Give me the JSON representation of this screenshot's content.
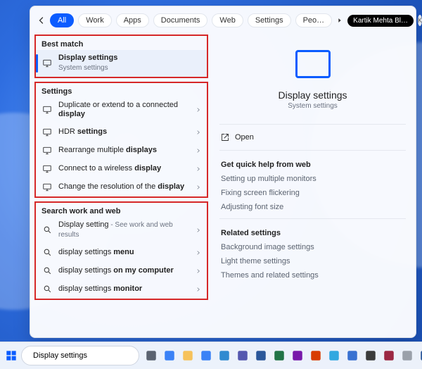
{
  "tabs": {
    "items": [
      "All",
      "Work",
      "Apps",
      "Documents",
      "Web",
      "Settings",
      "Peo…"
    ],
    "active_index": 0,
    "user_chip": "Kartik Mehta Bl…",
    "user_initial": "K"
  },
  "best_match": {
    "header": "Best match",
    "title": "Display settings",
    "subtitle": "System settings"
  },
  "settings": {
    "header": "Settings",
    "items": [
      {
        "pre": "Duplicate or extend to a connected ",
        "bold": "display"
      },
      {
        "pre": "HDR ",
        "bold": "settings"
      },
      {
        "pre": "Rearrange multiple ",
        "bold": "displays"
      },
      {
        "pre": "Connect to a wireless ",
        "bold": "display"
      },
      {
        "pre": "Change the resolution of the ",
        "bold": "display"
      }
    ]
  },
  "web": {
    "header": "Search work and web",
    "items": [
      {
        "pre": "Display setting",
        "suffix": " - See work and web results"
      },
      {
        "pre": "display settings ",
        "bold": "menu"
      },
      {
        "pre": "display settings ",
        "bold": "on my computer"
      },
      {
        "pre": "display settings ",
        "bold": "monitor"
      }
    ]
  },
  "preview": {
    "title": "Display settings",
    "subtitle": "System settings",
    "open_label": "Open",
    "quick_help_header": "Get quick help from web",
    "quick_help": [
      "Setting up multiple monitors",
      "Fixing screen flickering",
      "Adjusting font size"
    ],
    "related_header": "Related settings",
    "related": [
      "Background image settings",
      "Light theme settings",
      "Themes and related settings"
    ]
  },
  "taskbar": {
    "search_value": "Display settings",
    "pinned": [
      {
        "name": "task-view",
        "color": "#5b6370"
      },
      {
        "name": "widgets",
        "color": "#3b82f6"
      },
      {
        "name": "explorer",
        "color": "#f6c25b"
      },
      {
        "name": "store",
        "color": "#3b82f6"
      },
      {
        "name": "mail",
        "color": "#2f8ad0"
      },
      {
        "name": "teams",
        "color": "#5558af"
      },
      {
        "name": "word",
        "color": "#2b579a"
      },
      {
        "name": "excel",
        "color": "#217346"
      },
      {
        "name": "onenote",
        "color": "#7719aa"
      },
      {
        "name": "snip",
        "color": "#d83b01"
      },
      {
        "name": "edge",
        "color": "#31a8e0"
      },
      {
        "name": "todo",
        "color": "#3971d1"
      },
      {
        "name": "app-b",
        "color": "#3b3b3b"
      },
      {
        "name": "camera",
        "color": "#9b2743"
      },
      {
        "name": "app-c",
        "color": "#9aa0aa"
      },
      {
        "name": "app-d",
        "color": "#2b579a"
      },
      {
        "name": "powerpoint",
        "color": "#d24726"
      },
      {
        "name": "app-e",
        "color": "#2fa84f"
      }
    ]
  },
  "colors": {
    "accent": "#0b5cff",
    "highlight_border": "#d62828"
  }
}
